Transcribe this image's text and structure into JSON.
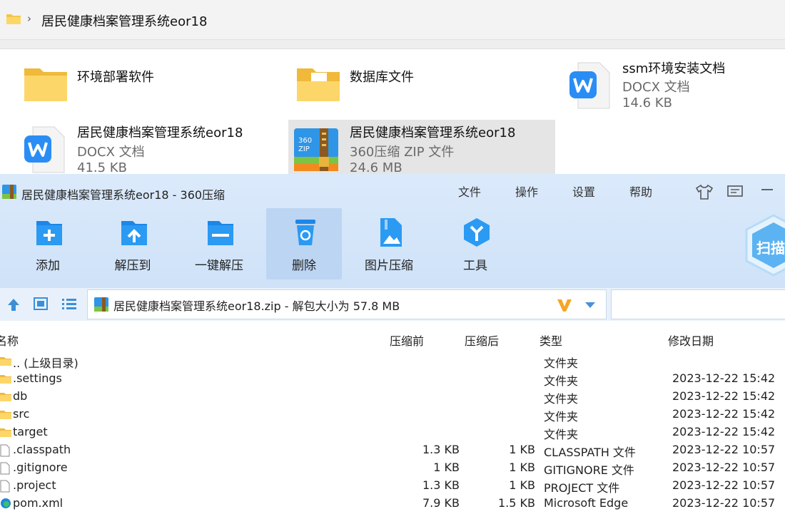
{
  "explorer": {
    "breadcrumb_title": "居民健康档案管理系统eor18",
    "breadcrumb_sep": "›",
    "items": [
      {
        "name": "环境部署软件",
        "sub1": "",
        "sub2": ""
      },
      {
        "name": "数据库文件",
        "sub1": "",
        "sub2": ""
      },
      {
        "name": "ssm环境安装文档",
        "sub1": "DOCX 文档",
        "sub2": "14.6 KB"
      },
      {
        "name": "居民健康档案管理系统eor18",
        "sub1": "DOCX 文档",
        "sub2": "41.5 KB"
      },
      {
        "name": "居民健康档案管理系统eor18",
        "sub1": "360压缩 ZIP 文件",
        "sub2": "24.6 MB"
      }
    ]
  },
  "zip": {
    "title": "居民健康档案管理系统eor18 - 360压缩",
    "menu": [
      "文件",
      "操作",
      "设置",
      "帮助"
    ],
    "scan_label": "扫描",
    "toolbar": [
      "添加",
      "解压到",
      "一键解压",
      "删除",
      "图片压缩",
      "工具"
    ],
    "address": "居民健康档案管理系统eor18.zip - 解包大小为 57.8 MB",
    "columns": {
      "name": "名称",
      "size": "压缩前",
      "comp": "压缩后",
      "type": "类型",
      "date": "修改日期"
    },
    "rows": [
      {
        "name": ".. (上级目录)",
        "size": "",
        "comp": "",
        "type": "文件夹",
        "date": "",
        "icon": "folder-icon"
      },
      {
        "name": ".settings",
        "size": "",
        "comp": "",
        "type": "文件夹",
        "date": "2023-12-22 15:42",
        "icon": "folder-icon"
      },
      {
        "name": "db",
        "size": "",
        "comp": "",
        "type": "文件夹",
        "date": "2023-12-22 15:42",
        "icon": "folder-icon"
      },
      {
        "name": "src",
        "size": "",
        "comp": "",
        "type": "文件夹",
        "date": "2023-12-22 15:42",
        "icon": "folder-icon"
      },
      {
        "name": "target",
        "size": "",
        "comp": "",
        "type": "文件夹",
        "date": "2023-12-22 15:42",
        "icon": "folder-icon"
      },
      {
        "name": ".classpath",
        "size": "1.3 KB",
        "comp": "1 KB",
        "type": "CLASSPATH 文件",
        "date": "2023-12-22 10:57",
        "icon": "file-icon"
      },
      {
        "name": ".gitignore",
        "size": "1 KB",
        "comp": "1 KB",
        "type": "GITIGNORE 文件",
        "date": "2023-12-22 10:57",
        "icon": "file-icon"
      },
      {
        "name": ".project",
        "size": "1.3 KB",
        "comp": "1 KB",
        "type": "PROJECT 文件",
        "date": "2023-12-22 10:57",
        "icon": "file-icon"
      },
      {
        "name": "pom.xml",
        "size": "7.9 KB",
        "comp": "1.5 KB",
        "type": "Microsoft Edge",
        "date": "2023-12-22 10:57",
        "icon": "edge-icon"
      }
    ]
  }
}
